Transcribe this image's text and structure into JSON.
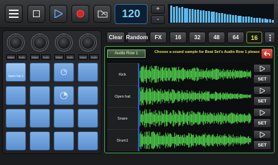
{
  "transport": {
    "tempo": "120",
    "plus": "+",
    "minus": "-"
  },
  "spectrum_levels": [
    0.95,
    0.9,
    0.92,
    0.85,
    0.88,
    0.8,
    0.82,
    0.78,
    0.75,
    0.72,
    0.74,
    0.7,
    0.68,
    0.66,
    0.64,
    0.6,
    0.62,
    0.58,
    0.55,
    0.52,
    0.5,
    0.48,
    0.46,
    0.44,
    0.42,
    0.4,
    0.38,
    0.36,
    0.35,
    0.33,
    0.3,
    0.28,
    0.27,
    0.25,
    0.24,
    0.22,
    0.2,
    0.18,
    0.16
  ],
  "mixer": {
    "channels": [
      {
        "mute": "Mute",
        "solo": "Solo"
      },
      {
        "mute": "Mute",
        "solo": "Solo"
      },
      {
        "mute": "Mute",
        "solo": "Solo"
      },
      {
        "mute": "Mute",
        "solo": "Solo"
      }
    ]
  },
  "pads": {
    "first_label": "Open hat 1"
  },
  "toolbar": {
    "clear": "Clear",
    "random": "Random",
    "fx": "FX",
    "steps": [
      "16",
      "32",
      "48",
      "64"
    ],
    "selected_steps": "16"
  },
  "sample_panel": {
    "row_tab": "Audio Row 1",
    "prompt": "Choose a sound sample for Beat Set's  Audio Row 1 please",
    "samples": [
      {
        "name": "Kick",
        "set": "SET"
      },
      {
        "name": "Open hat",
        "set": "SET"
      },
      {
        "name": "Snare",
        "set": "SET"
      },
      {
        "name": "Drum1",
        "set": "SET"
      }
    ]
  },
  "colors": {
    "accent_green": "#3fa84a",
    "waveform": "#4fd04a",
    "tempo_text": "#7fd0ff",
    "pad_blue": "#6d9fdc",
    "prompt_yellow": "#e8e050"
  }
}
